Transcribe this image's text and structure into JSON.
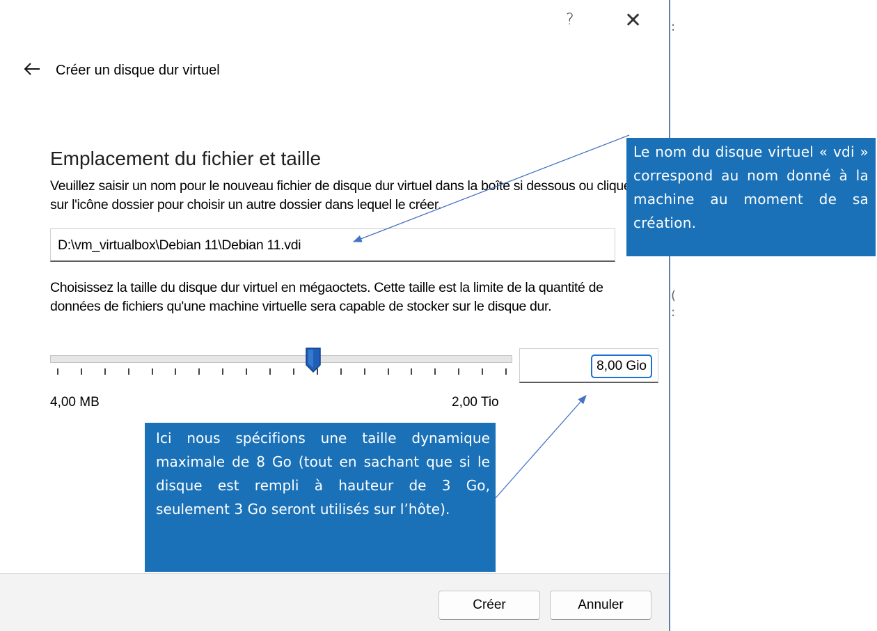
{
  "window": {
    "help": "?",
    "close": "✕"
  },
  "wizard": {
    "crumb": "Créer un disque dur virtuel",
    "heading": "Emplacement du fichier et taille",
    "location_help": "Veuillez saisir un nom pour le nouveau fichier de disque dur virtuel dans la boîte si dessous ou cliquez sur l'icône dossier pour choisir un autre dossier dans lequel le créer.",
    "file_path": "D:\\vm_virtualbox\\Debian 11\\Debian 11.vdi",
    "size_help": "Choisissez la taille du disque dur virtuel en mégaoctets. Cette taille est la limite de la quantité de données de fichiers qu'une machine virtuelle sera capable de stocker sur le disque dur.",
    "slider": {
      "min_label": "4,00 MB",
      "max_label": "2,00 Tio",
      "value_label": "8,00 Gio",
      "tick_count": 20,
      "position_fraction": 0.57
    },
    "buttons": {
      "create": "Créer",
      "cancel": "Annuler"
    }
  },
  "annotations": {
    "name_note": "Le nom du disque virtuel « vdi » correspond au nom donné à la machine au moment de sa création.",
    "size_note": "Ici nous spécifions une taille dynamique maximale de 8 Go (tout en sachant que si le disque est rempli à hauteur de 3 Go, seulement 3 Go seront utilisés sur l’hôte)."
  },
  "colors": {
    "callout_bg": "#1a71b8",
    "accent": "#1f6fcf",
    "thumb": "#1f5fb8"
  },
  "icons": {
    "back": "arrow-left-icon",
    "folder": "folder-icon"
  }
}
